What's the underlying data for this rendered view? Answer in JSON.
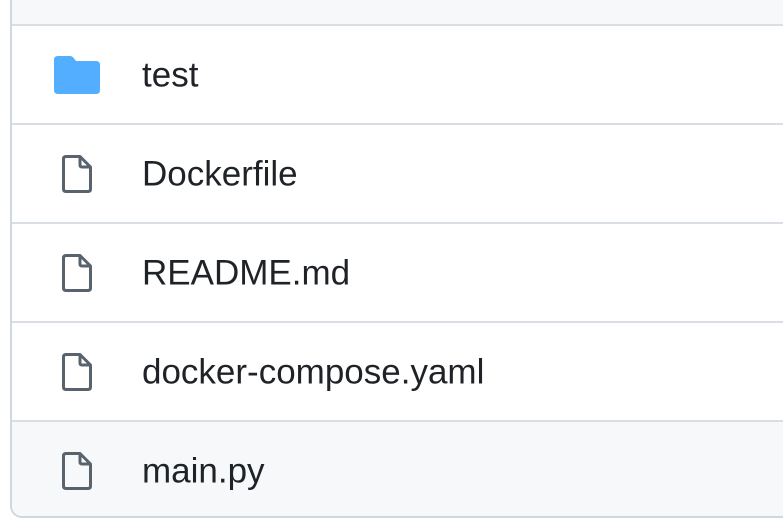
{
  "files": [
    {
      "name": "test",
      "icon": "folder-icon",
      "type": "directory"
    },
    {
      "name": "Dockerfile",
      "icon": "file-icon",
      "type": "file"
    },
    {
      "name": "README.md",
      "icon": "file-icon",
      "type": "file"
    },
    {
      "name": "docker-compose.yaml",
      "icon": "file-icon",
      "type": "file"
    },
    {
      "name": "main.py",
      "icon": "file-icon",
      "type": "file"
    }
  ],
  "colors": {
    "folder": "#54aeff",
    "file_icon": "#59636e",
    "text": "#1f2328",
    "border": "#d8dee4",
    "hover_row": "#f6f8fa"
  }
}
